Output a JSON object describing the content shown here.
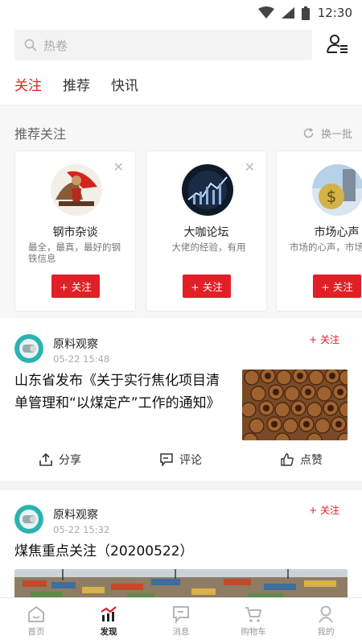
{
  "status_bar": {
    "time": "12:30",
    "icons": [
      "wifi-icon",
      "signal-icon",
      "battery-icon"
    ]
  },
  "search": {
    "placeholder": "热卷",
    "icon": "search-icon"
  },
  "header": {
    "user_list_icon": "user-list-icon"
  },
  "tabs": [
    {
      "label": "关注",
      "active": true
    },
    {
      "label": "推荐",
      "active": false
    },
    {
      "label": "快讯",
      "active": false
    }
  ],
  "recommend": {
    "title": "推荐关注",
    "refresh_label": "换一批",
    "cards": [
      {
        "name": "钢市杂谈",
        "desc": "最全，最真，最好的钢铁信息",
        "follow_label": "+ 关注"
      },
      {
        "name": "大咖论坛",
        "desc": "大佬的经验，有用",
        "follow_label": "+ 关注"
      },
      {
        "name": "市场心声",
        "desc": "市场的心声，市场动态",
        "follow_label": "+ 关注"
      }
    ]
  },
  "posts": [
    {
      "author": "原料观察",
      "time": "05-22 15:48",
      "follow_label": "+ 关注",
      "title_line1": "山东省发布《关于实行焦化项目清",
      "title_line2": "单管理和“以煤定产”工作的通知》",
      "actions": {
        "share": "分享",
        "comment": "评论",
        "like": "点赞"
      }
    },
    {
      "author": "原料观察",
      "time": "05-22 15:32",
      "follow_label": "+ 关注",
      "title_line1": "煤焦重点关注（20200522）"
    }
  ],
  "tabbar": [
    {
      "label": "首页",
      "icon": "home-icon",
      "active": false
    },
    {
      "label": "发现",
      "icon": "discover-chart-icon",
      "active": true
    },
    {
      "label": "消息",
      "icon": "message-icon",
      "active": false
    },
    {
      "label": "购物车",
      "icon": "cart-icon",
      "active": false
    },
    {
      "label": "我的",
      "icon": "profile-icon",
      "active": false
    }
  ],
  "colors": {
    "accent": "#e11f27",
    "muted": "#999999",
    "band": "#f7f7f7"
  }
}
